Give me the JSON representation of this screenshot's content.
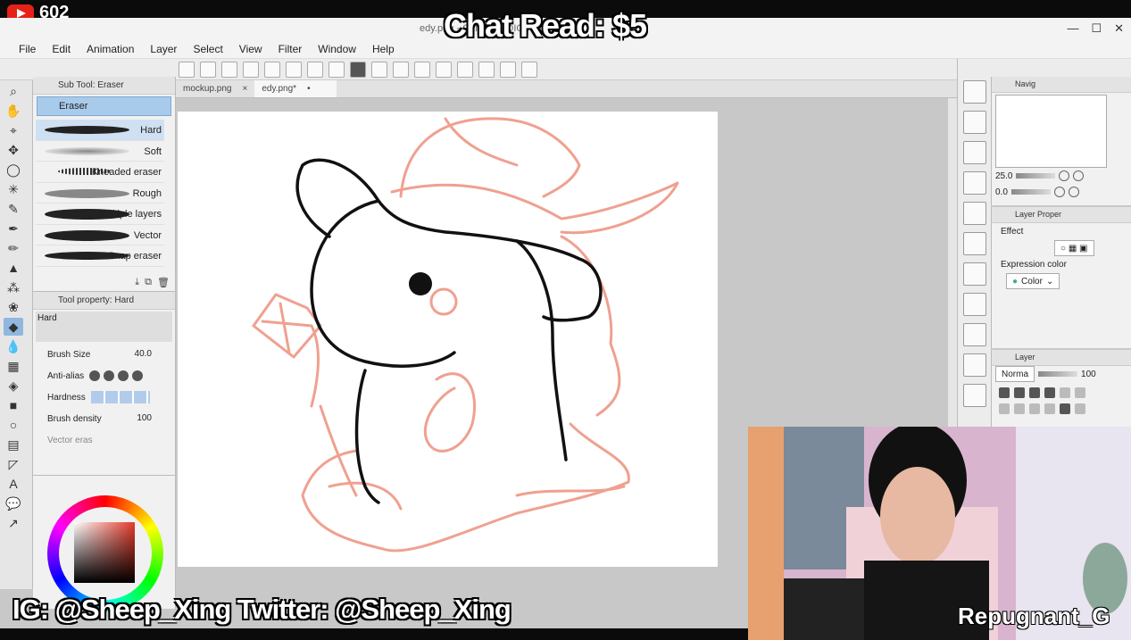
{
  "stream": {
    "viewer_count": "602",
    "chat_read": "Chat Read: $5",
    "socials": "IG: @Sheep_Xing  Twitter: @Sheep_Xing",
    "streamer_name": "Repugnant_G"
  },
  "window": {
    "title": "edy.png - CLIP STUDIO PAINT PRO"
  },
  "menu": [
    "File",
    "Edit",
    "Animation",
    "Layer",
    "Select",
    "View",
    "Filter",
    "Window",
    "Help"
  ],
  "subtool_panel": {
    "header": "Sub Tool: Eraser",
    "group": "Eraser",
    "items": [
      {
        "label": "Hard",
        "selected": true
      },
      {
        "label": "Soft"
      },
      {
        "label": "Kneaded eraser"
      },
      {
        "label": "Rough"
      },
      {
        "label": "Multiple layers"
      },
      {
        "label": "Vector"
      },
      {
        "label": "Snap eraser"
      }
    ]
  },
  "tool_property": {
    "header": "Tool property: Hard",
    "preset": "Hard",
    "brush_size_label": "Brush Size",
    "brush_size_value": "40.0",
    "anti_alias_label": "Anti-alias",
    "hardness_label": "Hardness",
    "brush_density_label": "Brush density",
    "brush_density_value": "100",
    "vector_erase_label": "Vector eras"
  },
  "tabs": [
    {
      "label": "mockup.png",
      "close": "×"
    },
    {
      "label": "edy.png*",
      "close": "•",
      "active": true
    }
  ],
  "navigator": {
    "header": "Navig",
    "zoom": "25.0",
    "rotation": "0.0"
  },
  "layer_property": {
    "header": "Layer Proper",
    "effect_label": "Effect",
    "expression_label": "Expression color",
    "expression_value": "Color"
  },
  "layer_panel": {
    "header": "Layer",
    "blend_mode": "Norma",
    "opacity": "100"
  },
  "colors": {
    "sketch_red": "#f0a090",
    "line_black": "#111111",
    "selected_blue": "#a9cbeb"
  }
}
